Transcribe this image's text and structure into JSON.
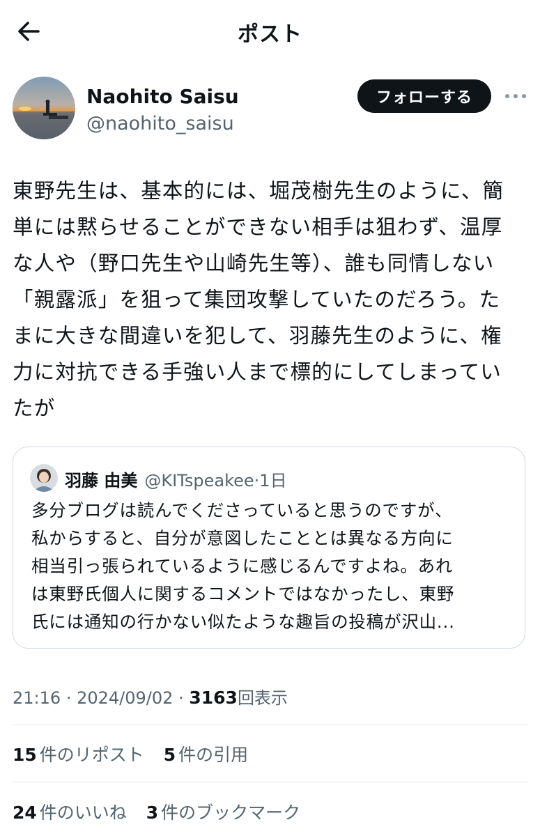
{
  "header": {
    "title": "ポスト",
    "back_icon": "arrow-left-icon"
  },
  "author": {
    "name": "Naohito Saisu",
    "handle": "@naohito_saisu",
    "follow_label": "フォローする",
    "more_icon": "more-horizontal-icon"
  },
  "post": {
    "lines": [
      "東野先生は、基本的には、堀茂樹先生のように、簡",
      "単には黙らせることができない相手は狙わず、温厚",
      "な人や（野口先生や山崎先生等）、誰も同情しない",
      "「親露派」を狙って集団攻撃していたのだろう。た",
      "まに大きな間違いを犯して、羽藤先生のように、権",
      "力に対抗できる手強い人まで標的にしてしまってい",
      "たが"
    ]
  },
  "quote": {
    "name": "羽藤 由美",
    "handle": "@KITspeakee",
    "separator": "·",
    "time": "1日",
    "lines": [
      "多分ブログは読んでくださっていると思うのですが、",
      "私からすると、自分が意図したこととは異なる方向に",
      "相当引っ張られているように感じるんですよね。あれ",
      "は東野氏個人に関するコメントではなかったし、東野",
      "氏には通知の行かない似たような趣旨の投稿が沢山..."
    ]
  },
  "meta": {
    "time": "21:16",
    "sep1": "·",
    "date": "2024/09/02",
    "sep2": "·",
    "views_count": "3163",
    "views_label": "回表示"
  },
  "stats": {
    "reposts_count": "15",
    "reposts_label": "件のリポスト",
    "quotes_count": "5",
    "quotes_label": "件の引用",
    "likes_count": "24",
    "likes_label": "件のいいね",
    "bookmarks_count": "3",
    "bookmarks_label": "件のブックマーク"
  },
  "colors": {
    "text_primary": "#0f1419",
    "text_secondary": "#536471",
    "border": "#cfd9de",
    "button_bg": "#0f1419"
  }
}
